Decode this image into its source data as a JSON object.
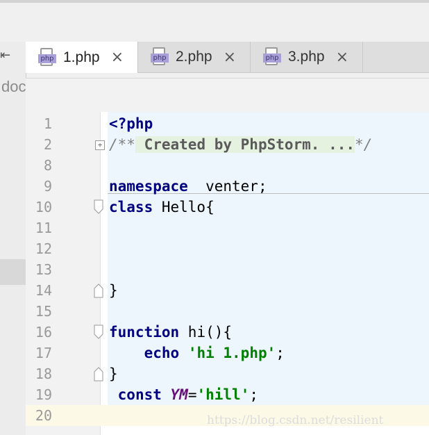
{
  "left_panel": {
    "collapse_icon": "collapse-left-icon",
    "doc_text": "doc"
  },
  "tabs": [
    {
      "label": "1.php",
      "icon": "php-file-icon",
      "active": true
    },
    {
      "label": "2.php",
      "icon": "php-file-icon",
      "active": false
    },
    {
      "label": "3.php",
      "icon": "php-file-icon",
      "active": false
    }
  ],
  "tab_close_glyph": "×",
  "php_icon_text": "php",
  "editor": {
    "line_numbers": [
      "1",
      "2",
      "8",
      "9",
      "10",
      "11",
      "12",
      "13",
      "14",
      "15",
      "16",
      "17",
      "18",
      "19",
      "20"
    ],
    "code": {
      "l1": "<?php",
      "l2_prefix": "/**",
      "l2_fold": " Created by PhpStorm. ...",
      "l2_suffix": "*/",
      "l9_kw": "namespace",
      "l9_rest": "  venter;",
      "l10_kw": "class",
      "l10_rest": " Hello{",
      "l14": "}",
      "l16_kw": "function",
      "l16_rest": " hi(){",
      "l17_indent": "    ",
      "l17_kw": "echo",
      "l17_sp": " ",
      "l17_str": "'hi 1.php'",
      "l17_end": ";",
      "l18": "}",
      "l19_indent": " ",
      "l19_kw": "const",
      "l19_sp": " ",
      "l19_name": "YM",
      "l19_eq": "=",
      "l19_str": "'hill'",
      "l19_end": ";"
    }
  },
  "watermark": "https://blog.csdn.net/resilient",
  "colors": {
    "keyword": "#000080",
    "string": "#008000",
    "constant": "#660e7a",
    "comment": "#808080"
  }
}
